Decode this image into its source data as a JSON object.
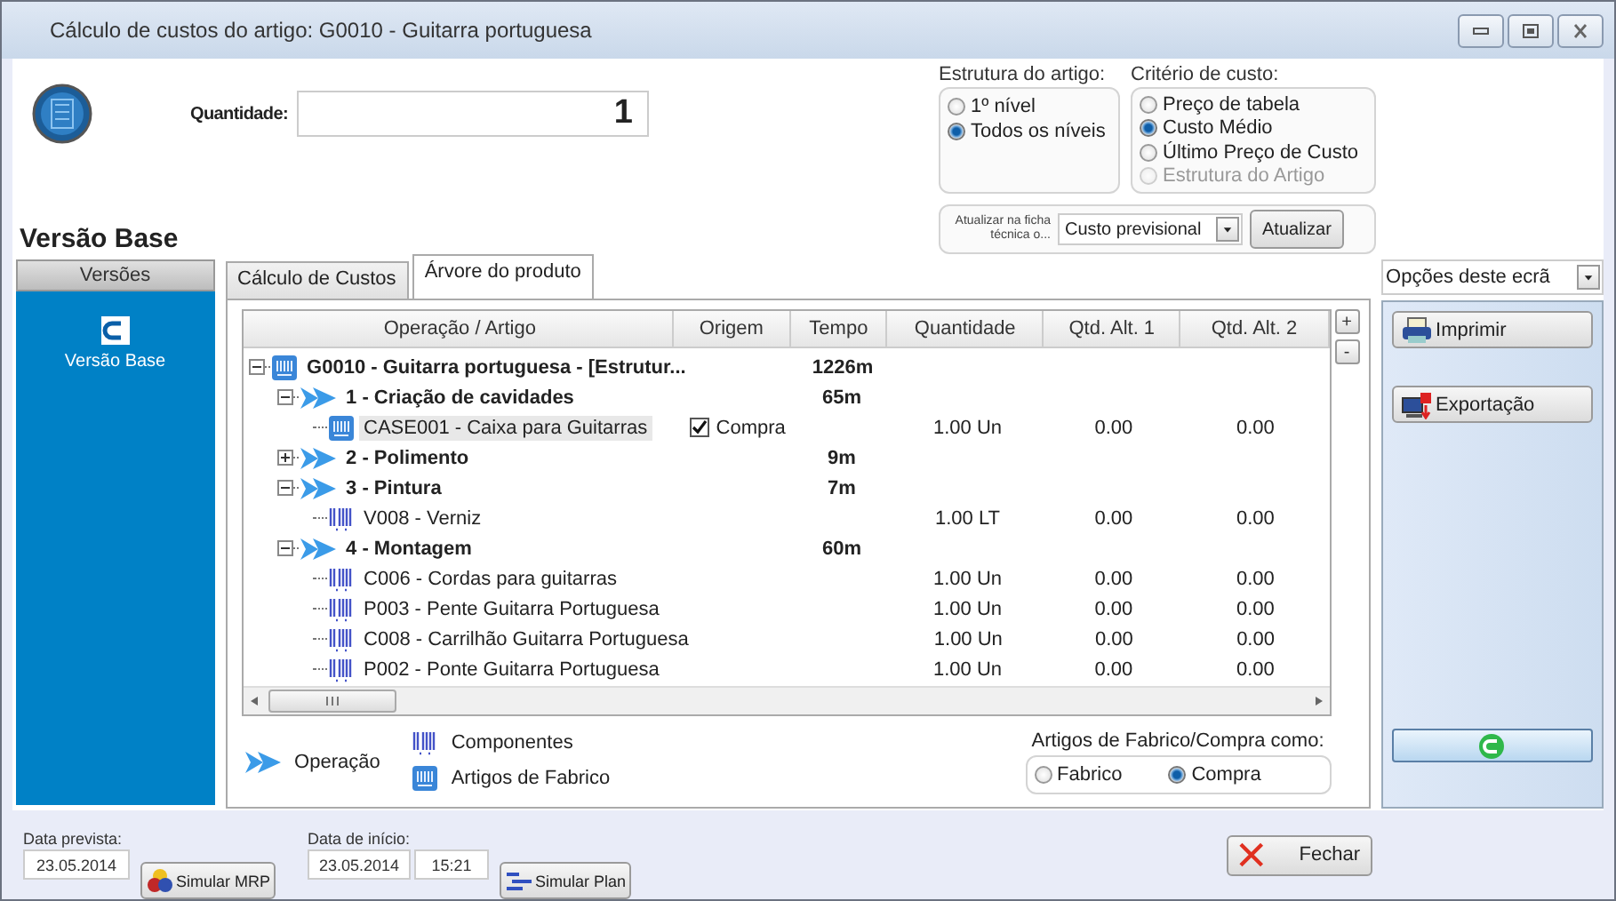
{
  "window": {
    "title": "Cálculo de custos do artigo: G0010 - Guitarra portuguesa"
  },
  "quantity": {
    "label": "Quantidade:",
    "value": "1"
  },
  "structure": {
    "label": "Estrutura do artigo:",
    "options": [
      {
        "label": "1º nível",
        "selected": false,
        "disabled": false
      },
      {
        "label": "Todos os níveis",
        "selected": true,
        "disabled": false
      }
    ]
  },
  "cost_criterion": {
    "label": "Critério de custo:",
    "options": [
      {
        "label": "Preço de tabela",
        "selected": false,
        "disabled": false
      },
      {
        "label": "Custo Médio",
        "selected": true,
        "disabled": false
      },
      {
        "label": "Último Preço de Custo",
        "selected": false,
        "disabled": false
      },
      {
        "label": "Estrutura do Artigo",
        "selected": false,
        "disabled": true
      }
    ]
  },
  "update": {
    "label": "Atualizar na ficha técnica o...",
    "value": "Custo previsional",
    "button": "Atualizar"
  },
  "version_title": "Versão Base",
  "versions": {
    "header": "Versões",
    "items": [
      {
        "label": "Versão Base",
        "selected": true
      }
    ]
  },
  "tabs": [
    {
      "label": "Cálculo de Custos",
      "selected": false
    },
    {
      "label": "Árvore do produto",
      "selected": true
    }
  ],
  "tree": {
    "columns": [
      "Operação / Artigo",
      "Origem",
      "Tempo",
      "Quantidade",
      "Qtd. Alt. 1",
      "Qtd. Alt. 2"
    ],
    "rows": [
      {
        "kind": "product",
        "label": "G0010 - Guitarra portuguesa - [Estrutur...",
        "bold": true,
        "expanded": true,
        "selected": false,
        "time": "1226m",
        "children": [
          {
            "kind": "operation",
            "label": "1 - Criação de cavidades",
            "bold": true,
            "expanded": true,
            "selected": false,
            "time": "65m",
            "children": [
              {
                "kind": "product",
                "label": "CASE001 - Caixa para Guitarras",
                "bold": false,
                "selected": true,
                "origin": {
                  "text": "Compra",
                  "checked": true
                },
                "quantity": "1.00 Un",
                "alt1": "0.00",
                "alt2": "0.00"
              }
            ]
          },
          {
            "kind": "operation",
            "label": "2 - Polimento",
            "bold": true,
            "expanded": false,
            "selected": false,
            "time": "9m"
          },
          {
            "kind": "operation",
            "label": "3 - Pintura",
            "bold": true,
            "expanded": true,
            "selected": false,
            "time": "7m",
            "children": [
              {
                "kind": "component",
                "label": "V008 - Verniz",
                "bold": false,
                "selected": false,
                "quantity": "1.00 LT",
                "alt1": "0.00",
                "alt2": "0.00"
              }
            ]
          },
          {
            "kind": "operation",
            "label": "4 - Montagem",
            "bold": true,
            "expanded": true,
            "selected": false,
            "time": "60m",
            "children": [
              {
                "kind": "component",
                "label": "C006 - Cordas para guitarras",
                "bold": false,
                "selected": false,
                "quantity": "1.00 Un",
                "alt1": "0.00",
                "alt2": "0.00"
              },
              {
                "kind": "component",
                "label": "P003 - Pente Guitarra Portuguesa",
                "bold": false,
                "selected": false,
                "quantity": "1.00 Un",
                "alt1": "0.00",
                "alt2": "0.00"
              },
              {
                "kind": "component",
                "label": "C008 - Carrilhão Guitarra Portuguesa",
                "bold": false,
                "selected": false,
                "quantity": "1.00 Un",
                "alt1": "0.00",
                "alt2": "0.00"
              },
              {
                "kind": "component",
                "label": "P002 - Ponte Guitarra Portuguesa",
                "bold": false,
                "selected": false,
                "quantity": "1.00 Un",
                "alt1": "0.00",
                "alt2": "0.00"
              }
            ]
          }
        ]
      }
    ]
  },
  "tree_buttons": [
    "+",
    "-"
  ],
  "legend": [
    {
      "kind": "operation",
      "label": "Operação"
    },
    {
      "kind": "component",
      "label": "Componentes"
    },
    {
      "kind": "product",
      "label": "Artigos de Fabrico"
    }
  ],
  "article_mode": {
    "label": "Artigos de Fabrico/Compra como:",
    "options": [
      {
        "label": "Fabrico",
        "selected": false
      },
      {
        "label": "Compra",
        "selected": true
      }
    ]
  },
  "screen_options": {
    "value": "Opções deste ecrã"
  },
  "side_buttons": [
    {
      "kind": "print",
      "label": "Imprimir"
    },
    {
      "kind": "export",
      "label": "Exportação"
    }
  ],
  "footer": {
    "planned_label": "Data prevista:",
    "planned_date": "23.05.2014",
    "simulate_mrp": "Simular MRP",
    "start_label": "Data de início:",
    "start_date": "23.05.2014",
    "start_time": "15:21",
    "simulate_plan": "Simular Plan",
    "close": "Fechar"
  }
}
